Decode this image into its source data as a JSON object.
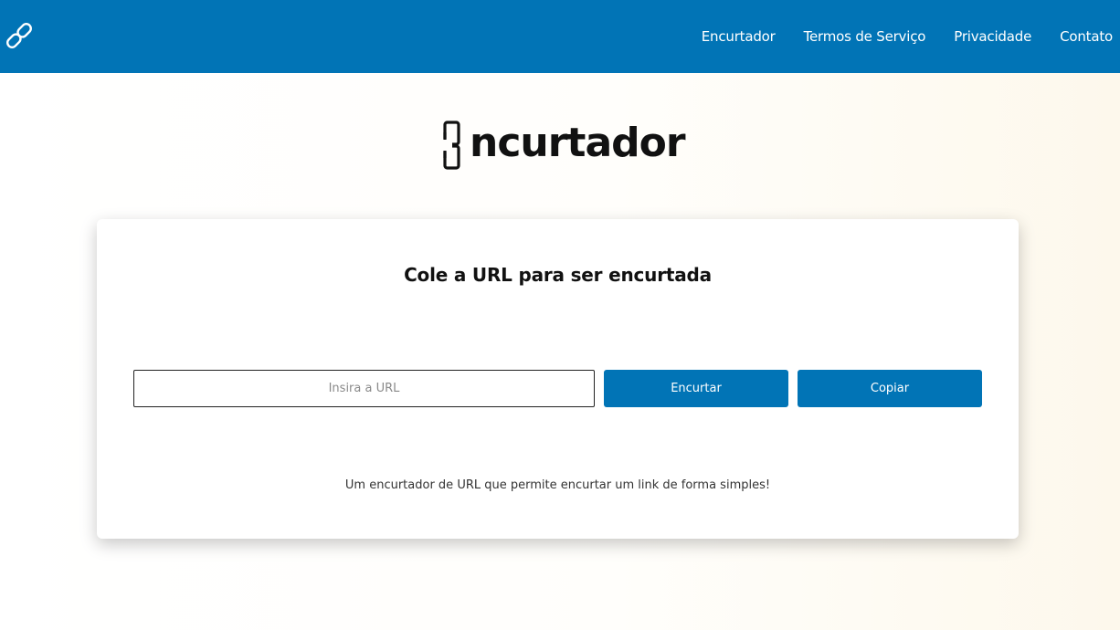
{
  "nav": {
    "logo_icon": "link-icon",
    "links": [
      "Encurtador",
      "Termos de Serviço",
      "Privacidade",
      "Contato"
    ],
    "background_color": "#0174b6"
  },
  "brand": {
    "icon": "link-icon",
    "text": "ncurtador"
  },
  "card": {
    "title": "Cole a URL para ser encurtada",
    "input_placeholder": "Insira a URL",
    "input_value": "",
    "shorten_label": "Encurtar",
    "copy_label": "Copiar",
    "description": "Um encurtador de URL que permite encurtar um link de forma simples!",
    "button_color": "#0174b6"
  }
}
